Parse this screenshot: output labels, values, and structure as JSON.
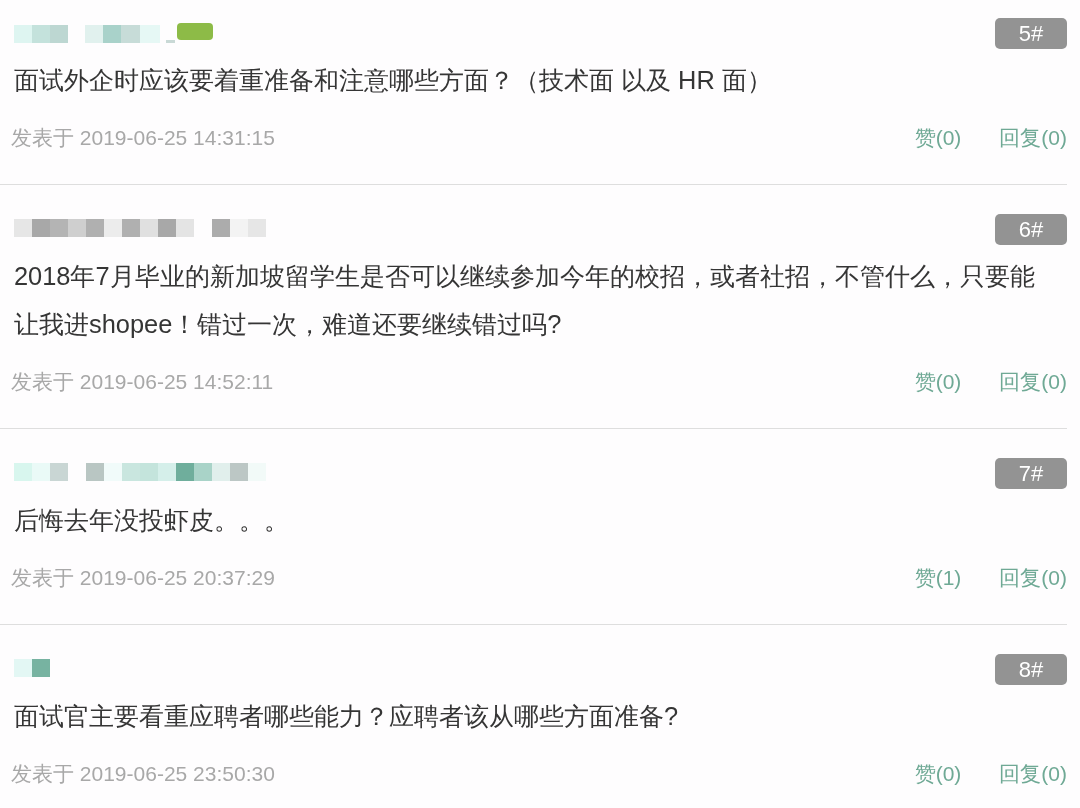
{
  "posts": [
    {
      "floor": "5#",
      "content": "面试外企时应该要着重准备和注意哪些方面？（技术面 以及 HR 面）",
      "posted_at": "发表于 2019-06-25 14:31:15",
      "likes": "赞(0)",
      "replies": "回复(0)"
    },
    {
      "floor": "6#",
      "content": "2018年7月毕业的新加坡留学生是否可以继续参加今年的校招，或者社招，不管什么，只要能让我进shopee！错过一次，难道还要继续错过吗?",
      "posted_at": "发表于 2019-06-25 14:52:11",
      "likes": "赞(0)",
      "replies": "回复(0)"
    },
    {
      "floor": "7#",
      "content": "后悔去年没投虾皮。。。",
      "posted_at": "发表于 2019-06-25 20:37:29",
      "likes": "赞(1)",
      "replies": "回复(0)"
    },
    {
      "floor": "8#",
      "content": "面试官主要看重应聘者哪些能力？应聘者该从哪些方面准备?",
      "posted_at": "发表于 2019-06-25 23:50:30",
      "likes": "赞(0)",
      "replies": "回复(0)"
    }
  ]
}
